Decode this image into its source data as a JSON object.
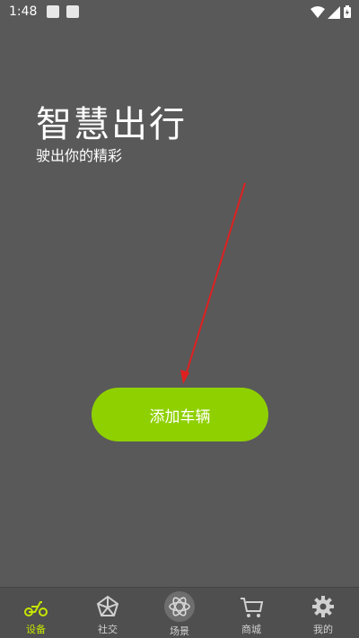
{
  "status_bar": {
    "time": "1:48"
  },
  "hero": {
    "title": "智慧出行",
    "subtitle": "驶出你的精彩"
  },
  "main": {
    "add_vehicle_label": "添加车辆"
  },
  "colors": {
    "background": "#595959",
    "accent": "#8fd000",
    "active_tab": "#c7e600",
    "arrow": "#e02020"
  },
  "tabbar": {
    "items": [
      {
        "label": "设备",
        "icon": "scooter-icon",
        "active": true
      },
      {
        "label": "社交",
        "icon": "network-icon",
        "active": false
      },
      {
        "label": "场景",
        "icon": "atom-icon",
        "active": false
      },
      {
        "label": "商城",
        "icon": "cart-icon",
        "active": false
      },
      {
        "label": "我的",
        "icon": "gear-icon",
        "active": false
      }
    ]
  }
}
